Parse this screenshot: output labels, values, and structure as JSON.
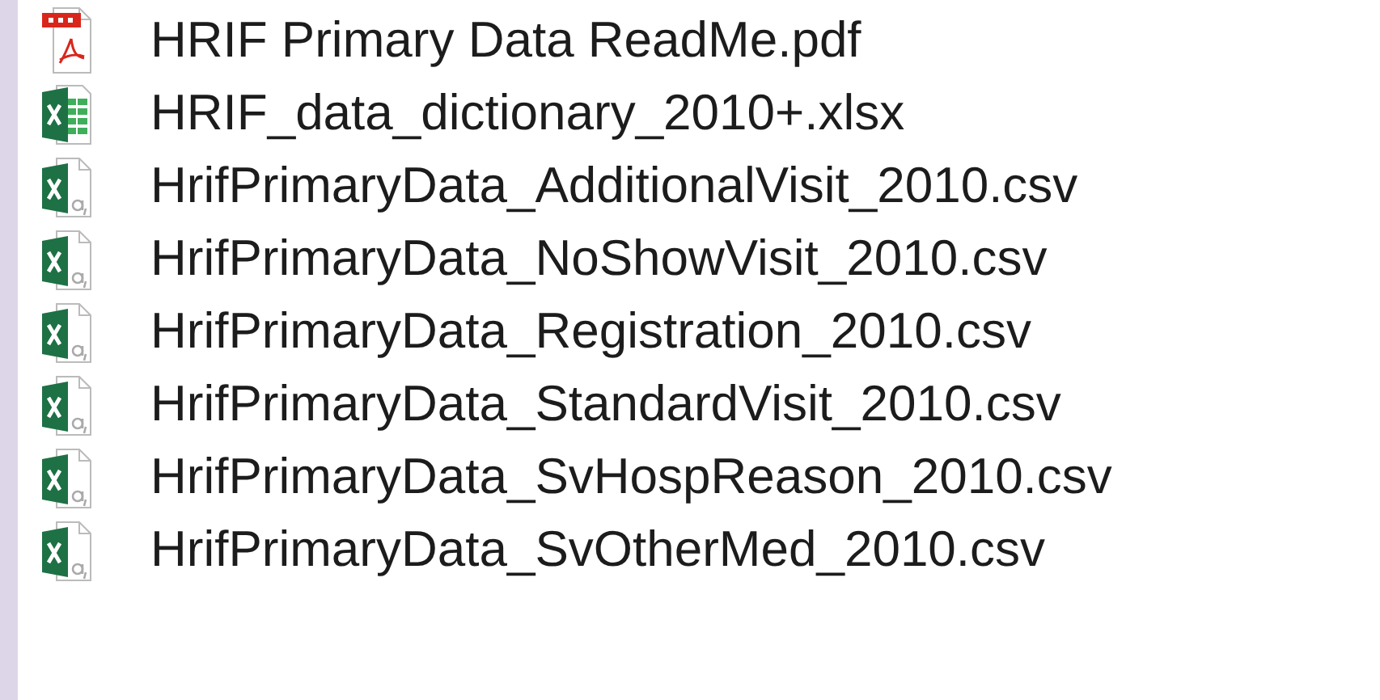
{
  "files": [
    {
      "name": "HRIF Primary Data ReadMe.pdf",
      "kind": "pdf"
    },
    {
      "name": "HRIF_data_dictionary_2010+.xlsx",
      "kind": "workbook"
    },
    {
      "name": "HrifPrimaryData_AdditionalVisit_2010.csv",
      "kind": "csv"
    },
    {
      "name": "HrifPrimaryData_NoShowVisit_2010.csv",
      "kind": "csv"
    },
    {
      "name": "HrifPrimaryData_Registration_2010.csv",
      "kind": "csv"
    },
    {
      "name": "HrifPrimaryData_StandardVisit_2010.csv",
      "kind": "csv"
    },
    {
      "name": "HrifPrimaryData_SvHospReason_2010.csv",
      "kind": "csv"
    },
    {
      "name": "HrifPrimaryData_SvOtherMed_2010.csv",
      "kind": "csv"
    }
  ]
}
